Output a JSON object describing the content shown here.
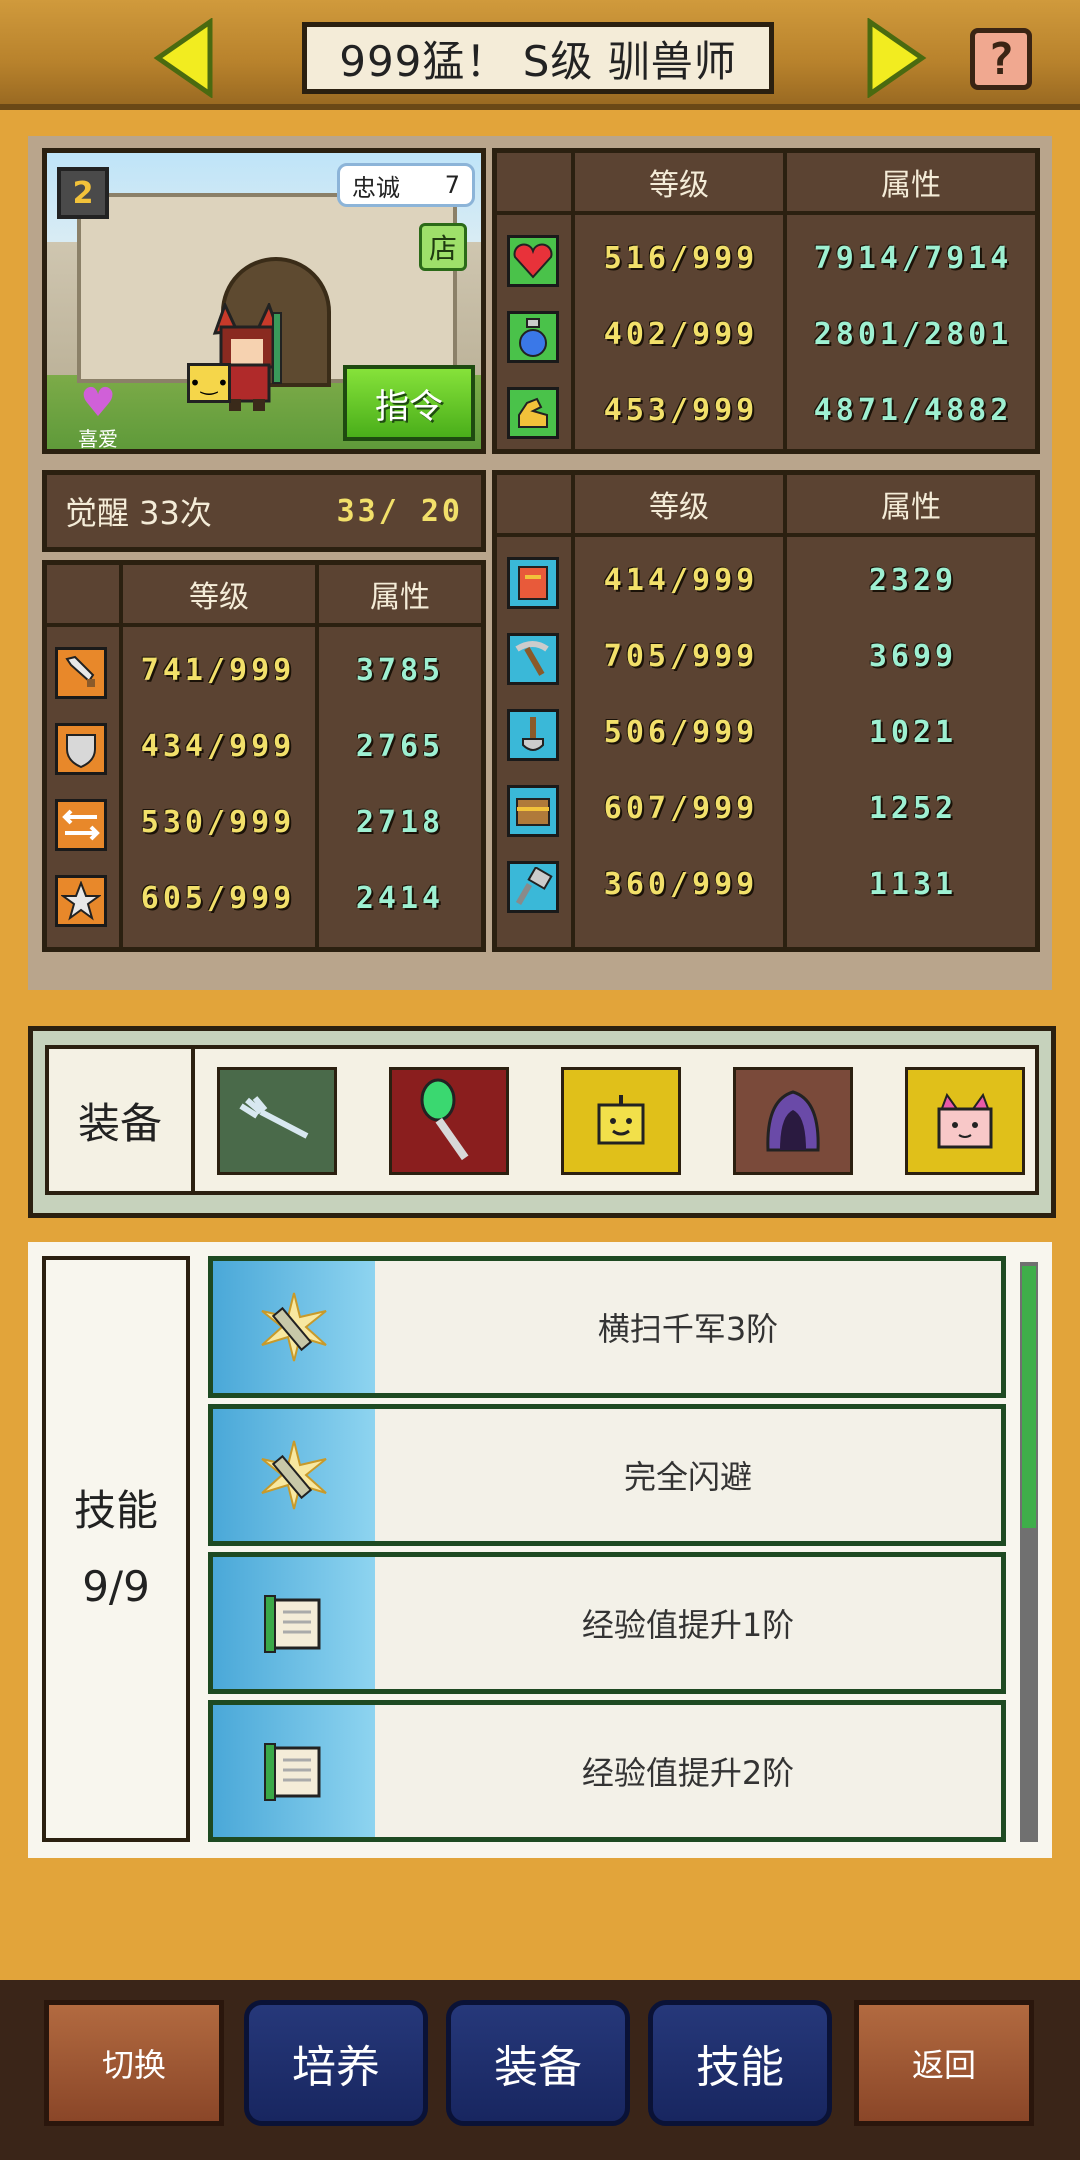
{
  "header": {
    "title": "999猛！ S级 驯兽师",
    "prev_icon": "left-arrow",
    "next_icon": "right-arrow",
    "help_label": "?"
  },
  "portrait": {
    "rank": "2",
    "loyalty_label": "忠诚",
    "loyalty_value": "7",
    "shop_label": "店",
    "like_label": "喜爱",
    "command_label": "指令"
  },
  "main_stats": {
    "col_level": "等级",
    "col_attr": "属性",
    "rows": [
      {
        "icon": "heart-icon",
        "color": "#e8323a",
        "level": "516/999",
        "attr": "7914/7914"
      },
      {
        "icon": "potion-icon",
        "color": "#3a78e8",
        "level": "402/999",
        "attr": "2801/2801"
      },
      {
        "icon": "strength-icon",
        "color": "#f2c23a",
        "level": "453/999",
        "attr": "4871/4882"
      }
    ]
  },
  "awaken": {
    "label": "觉醒 33次",
    "value": "33/ 20"
  },
  "combat_stats": {
    "col_level": "等级",
    "col_attr": "属性",
    "rows": [
      {
        "icon": "sword-icon",
        "level": "741/999",
        "attr": "3785"
      },
      {
        "icon": "shield-icon",
        "level": "434/999",
        "attr": "2765"
      },
      {
        "icon": "agility-icon",
        "level": "530/999",
        "attr": "2718"
      },
      {
        "icon": "star-icon",
        "level": "605/999",
        "attr": "2414"
      }
    ]
  },
  "work_stats": {
    "col_level": "等级",
    "col_attr": "属性",
    "rows": [
      {
        "icon": "book-icon",
        "level": "414/999",
        "attr": "2329"
      },
      {
        "icon": "pickaxe-icon",
        "level": "705/999",
        "attr": "3699"
      },
      {
        "icon": "shovel-icon",
        "level": "506/999",
        "attr": "1021"
      },
      {
        "icon": "chest-icon",
        "level": "607/999",
        "attr": "1252"
      },
      {
        "icon": "hammer-icon",
        "level": "360/999",
        "attr": "1131"
      }
    ]
  },
  "equipment": {
    "label": "装备",
    "slots": [
      {
        "icon": "claw-weapon-icon",
        "bg": "#4a6a4a"
      },
      {
        "icon": "green-staff-icon",
        "bg": "#8a1e1e"
      },
      {
        "icon": "yellow-robot-icon",
        "bg": "#e0c01a"
      },
      {
        "icon": "purple-hood-icon",
        "bg": "#7a4a3a"
      },
      {
        "icon": "pink-cat-icon",
        "bg": "#e0c01a"
      }
    ]
  },
  "skills": {
    "label": "技能",
    "count": "9/9",
    "items": [
      {
        "icon": "sword-burst-icon",
        "name": "横扫千军3阶"
      },
      {
        "icon": "sword-burst-icon",
        "name": "完全闪避"
      },
      {
        "icon": "scroll-icon",
        "name": "经验值提升1阶"
      },
      {
        "icon": "scroll-icon",
        "name": "经验值提升2阶"
      }
    ]
  },
  "nav": {
    "switch": "切换",
    "train": "培养",
    "equip": "装备",
    "skill": "技能",
    "back": "返回"
  }
}
